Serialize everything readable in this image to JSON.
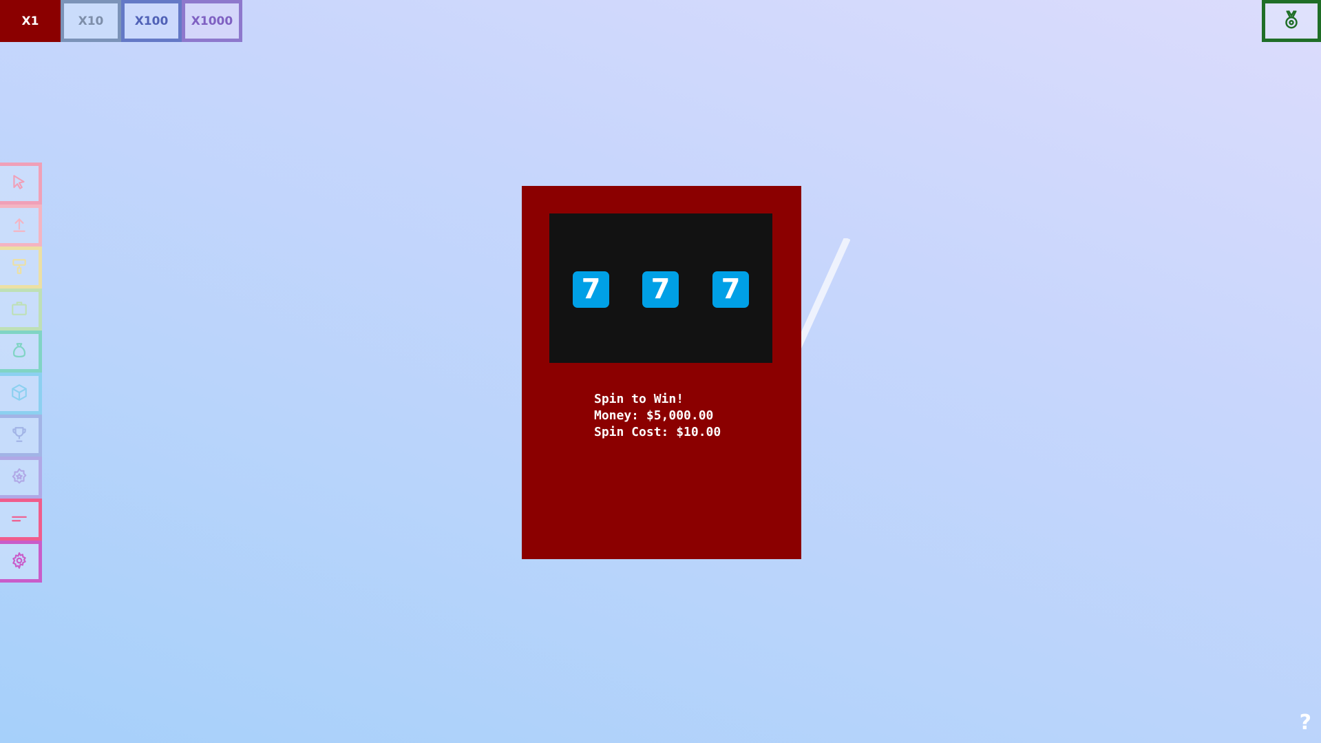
{
  "multipliers": [
    {
      "label": "X1",
      "active": true
    },
    {
      "label": "X10",
      "active": false
    },
    {
      "label": "X100",
      "active": false
    },
    {
      "label": "X1000",
      "active": false
    }
  ],
  "top_right": {
    "icon": "medal-icon",
    "color": "#1f6e27"
  },
  "sidebar": [
    {
      "icon": "cursor-icon",
      "color": "#f0a0b8"
    },
    {
      "icon": "upload-arrow-icon",
      "color": "#f4b4c2"
    },
    {
      "icon": "paint-roller-icon",
      "color": "#ece0a4"
    },
    {
      "icon": "briefcase-icon",
      "color": "#bee0b6"
    },
    {
      "icon": "money-bag-icon",
      "color": "#80d4c4"
    },
    {
      "icon": "cube-icon",
      "color": "#8cd0f0"
    },
    {
      "icon": "trophy-icon",
      "color": "#a2b4e6"
    },
    {
      "icon": "star-badge-icon",
      "color": "#b0a8e6"
    },
    {
      "icon": "menu-lines-icon",
      "color": "#f05c8c"
    },
    {
      "icon": "gear-icon",
      "color": "#c95cc9"
    }
  ],
  "machine": {
    "color": "#8b0000",
    "reels": [
      "7",
      "7",
      "7"
    ],
    "reel_color": "#00a0e6",
    "status": "Spin to Win!",
    "money_line": "Money: $5,000.00",
    "cost_line": "Spin Cost: $10.00"
  },
  "help_label": "?"
}
